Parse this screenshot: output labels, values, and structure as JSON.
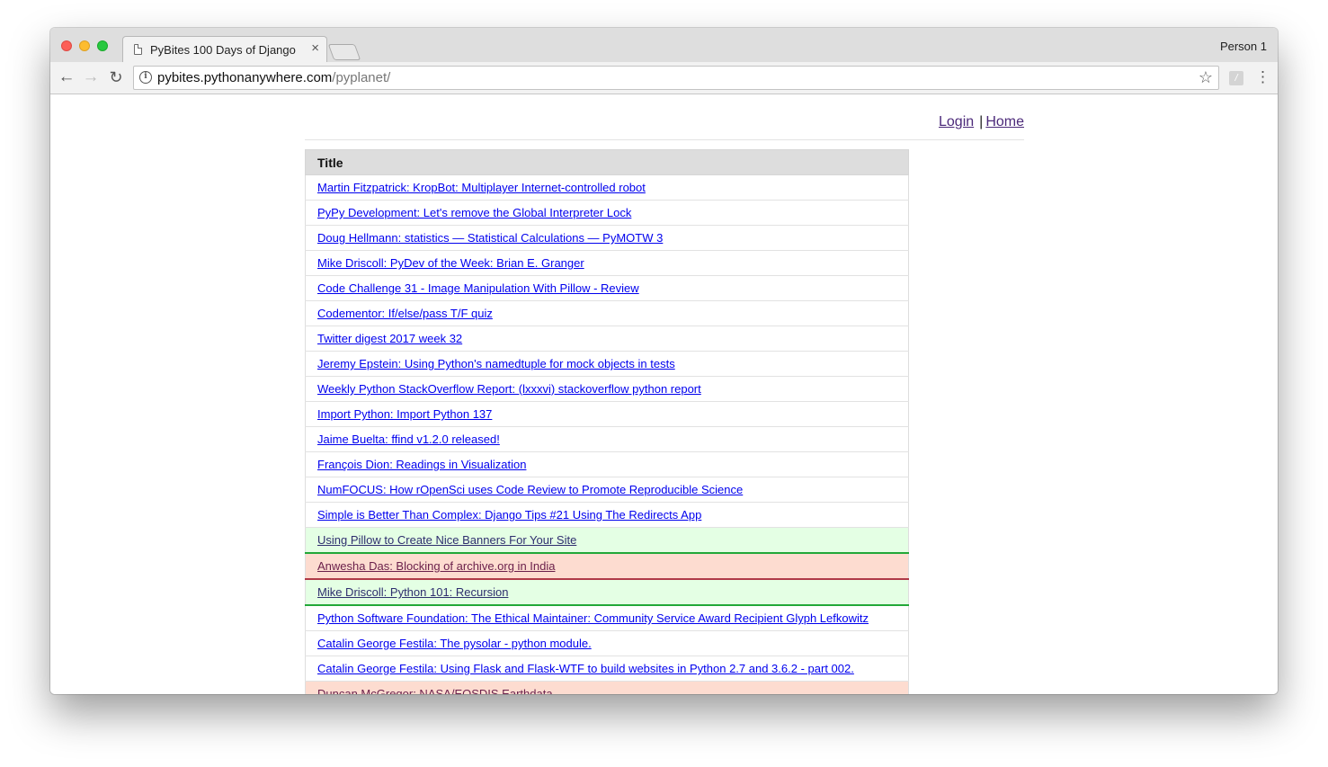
{
  "browser": {
    "tab_title": "PyBites 100 Days of Django",
    "tab_close": "×",
    "profile_name": "Person 1",
    "url_host": "pybites.pythonanywhere.com",
    "url_path": "/pyplanet/",
    "icons": {
      "back": "←",
      "forward": "→",
      "reload": "↻",
      "info": "i",
      "star": "☆",
      "menu": "⋮",
      "extension": "/"
    }
  },
  "nav": {
    "login": "Login",
    "separator": "|",
    "home": "Home"
  },
  "table": {
    "header": "Title",
    "rows": [
      {
        "title": "Martin Fitzpatrick: KropBot: Multiplayer Internet-controlled robot",
        "status": "none"
      },
      {
        "title": "PyPy Development: Let's remove the Global Interpreter Lock",
        "status": "none"
      },
      {
        "title": "Doug Hellmann: statistics — Statistical Calculations — PyMOTW 3",
        "status": "none"
      },
      {
        "title": "Mike Driscoll: PyDev of the Week: Brian E. Granger",
        "status": "none"
      },
      {
        "title": "Code Challenge 31 - Image Manipulation With Pillow - Review",
        "status": "none"
      },
      {
        "title": "Codementor: If/else/pass T/F quiz",
        "status": "none"
      },
      {
        "title": "Twitter digest 2017 week 32",
        "status": "none"
      },
      {
        "title": "Jeremy Epstein: Using Python's namedtuple for mock objects in tests",
        "status": "none"
      },
      {
        "title": "Weekly Python StackOverflow Report: (lxxxvi) stackoverflow python report",
        "status": "none"
      },
      {
        "title": "Import Python: Import Python 137",
        "status": "none"
      },
      {
        "title": "Jaime Buelta: ffind v1.2.0 released!",
        "status": "none"
      },
      {
        "title": "François Dion: Readings in Visualization",
        "status": "none"
      },
      {
        "title": "NumFOCUS: How rOpenSci uses Code Review to Promote Reproducible Science",
        "status": "none"
      },
      {
        "title": "Simple is Better Than Complex: Django Tips #21 Using The Redirects App",
        "status": "none"
      },
      {
        "title": "Using Pillow to Create Nice Banners For Your Site",
        "status": "green"
      },
      {
        "title": "Anwesha Das: Blocking of archive.org in India",
        "status": "red"
      },
      {
        "title": "Mike Driscoll: Python 101: Recursion",
        "status": "green"
      },
      {
        "title": "Python Software Foundation: The Ethical Maintainer: Community Service Award Recipient Glyph Lefkowitz",
        "status": "none"
      },
      {
        "title": "Catalin George Festila: The pysolar - python module.",
        "status": "none"
      },
      {
        "title": "Catalin George Festila: Using Flask and Flask-WTF to build websites in Python 2.7 and 3.6.2 - part 002.",
        "status": "none"
      },
      {
        "title": "Duncan McGregor: NASA/EOSDIS Earthdata",
        "status": "peach"
      }
    ]
  },
  "colors": {
    "link": "#0000ee",
    "visited_nav": "#4c2a7a",
    "green_row_bg": "#e4ffe4",
    "green_row_border": "#22a838",
    "red_row_bg": "#fddcd0",
    "red_row_border": "#b03a48"
  }
}
